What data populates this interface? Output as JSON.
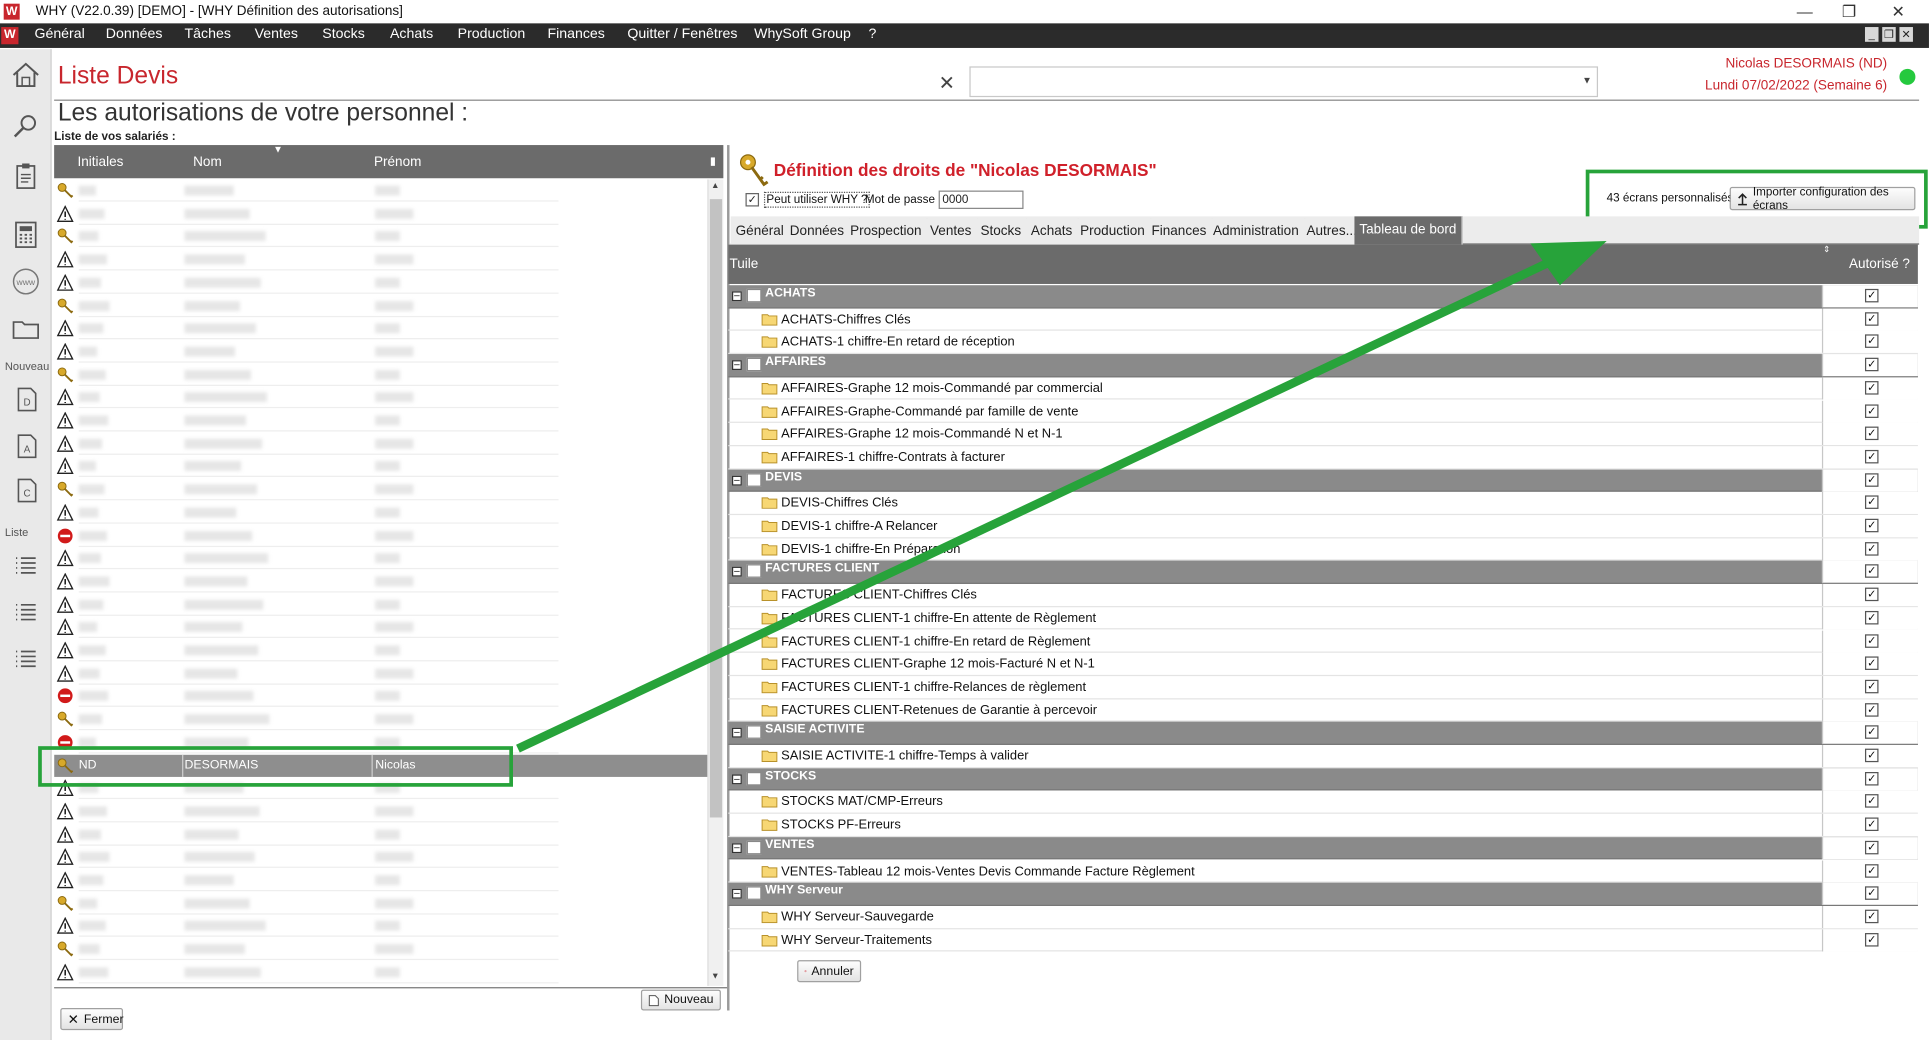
{
  "window": {
    "title": "WHY (V22.0.39)  [DEMO] - [WHY Définition des autorisations]",
    "logo": "W"
  },
  "menu": {
    "items": [
      "Général",
      "Données",
      "Tâches",
      "Ventes",
      "Stocks",
      "Achats",
      "Production",
      "Finances",
      "Quitter / Fenêtres",
      "WhySoft Group",
      "?"
    ]
  },
  "sidebar": {
    "nouveau_label": "Nouveau",
    "liste_label": "Liste"
  },
  "header": {
    "page_title": "Liste Devis",
    "user_name": "Nicolas DESORMAIS (ND)",
    "user_date": "Lundi 07/02/2022 (Semaine 6)",
    "status_color": "#25c93e"
  },
  "main": {
    "subtitle": "Les autorisations de votre personnel :",
    "employees_label": "Liste de vos salariés :"
  },
  "employees": {
    "columns": [
      "Initiales",
      "Nom",
      "Prénom"
    ],
    "selected": {
      "initials": "ND",
      "nom": "DESORMAIS",
      "prenom": "Nicolas"
    },
    "row_statuses": [
      "key",
      "warn",
      "key",
      "warn",
      "warn",
      "key",
      "warn",
      "warn",
      "key",
      "warn",
      "warn",
      "warn",
      "warn",
      "key",
      "warn",
      "stop",
      "warn",
      "warn",
      "warn",
      "warn",
      "warn",
      "warn",
      "stop",
      "key",
      "stop",
      "key",
      "warn",
      "warn",
      "warn",
      "warn",
      "warn",
      "key",
      "warn",
      "key",
      "warn"
    ],
    "selected_index": 25
  },
  "buttons": {
    "fermer": "Fermer",
    "nouveau": "Nouveau",
    "annuler": "Annuler",
    "import": "Importer configuration des écrans"
  },
  "rights": {
    "title": "Définition des droits de \"Nicolas DESORMAIS\"",
    "can_use_label": "Peut utiliser WHY ?",
    "can_use_checked": true,
    "password_label": "Mot de passe :",
    "password_value": "0000",
    "screens_count": "43 écrans personnalisés",
    "tabs": [
      "Général",
      "Données",
      "Prospection",
      "Ventes",
      "Stocks",
      "Achats",
      "Production",
      "Finances",
      "Administration",
      "Autres...",
      "Tableau de bord"
    ],
    "active_tab": "Tableau de bord",
    "grid_headers": {
      "tuile": "Tuile",
      "autorise": "Autorisé ?"
    },
    "rows": [
      {
        "type": "group",
        "label": "ACHATS"
      },
      {
        "type": "item",
        "label": "ACHATS-Chiffres Clés"
      },
      {
        "type": "item",
        "label": "ACHATS-1 chiffre-En retard de réception"
      },
      {
        "type": "group",
        "label": "AFFAIRES"
      },
      {
        "type": "item",
        "label": "AFFAIRES-Graphe 12 mois-Commandé par commercial"
      },
      {
        "type": "item",
        "label": "AFFAIRES-Graphe-Commandé par famille de vente"
      },
      {
        "type": "item",
        "label": "AFFAIRES-Graphe 12 mois-Commandé N et N-1"
      },
      {
        "type": "item",
        "label": "AFFAIRES-1 chiffre-Contrats à facturer"
      },
      {
        "type": "group",
        "label": "DEVIS"
      },
      {
        "type": "item",
        "label": "DEVIS-Chiffres Clés"
      },
      {
        "type": "item",
        "label": "DEVIS-1 chiffre-A Relancer"
      },
      {
        "type": "item",
        "label": "DEVIS-1 chiffre-En Préparation"
      },
      {
        "type": "group",
        "label": "FACTURES CLIENT"
      },
      {
        "type": "item",
        "label": "FACTURES CLIENT-Chiffres Clés"
      },
      {
        "type": "item",
        "label": "FACTURES CLIENT-1 chiffre-En attente de Règlement"
      },
      {
        "type": "item",
        "label": "FACTURES CLIENT-1 chiffre-En retard de Règlement"
      },
      {
        "type": "item",
        "label": "FACTURES CLIENT-Graphe 12 mois-Facturé N et N-1"
      },
      {
        "type": "item",
        "label": "FACTURES CLIENT-1 chiffre-Relances de règlement"
      },
      {
        "type": "item",
        "label": "FACTURES CLIENT-Retenues de Garantie à percevoir"
      },
      {
        "type": "group",
        "label": "SAISIE ACTIVITE"
      },
      {
        "type": "item",
        "label": "SAISIE ACTIVITE-1 chiffre-Temps à valider"
      },
      {
        "type": "group",
        "label": "STOCKS"
      },
      {
        "type": "item",
        "label": "STOCKS MAT/CMP-Erreurs"
      },
      {
        "type": "item",
        "label": "STOCKS PF-Erreurs"
      },
      {
        "type": "group",
        "label": "VENTES"
      },
      {
        "type": "item",
        "label": "VENTES-Tableau 12 mois-Ventes Devis Commande Facture Règlement"
      },
      {
        "type": "group",
        "label": "WHY Serveur"
      },
      {
        "type": "item",
        "label": "WHY Serveur-Sauvegarde"
      },
      {
        "type": "item",
        "label": "WHY Serveur-Traitements"
      }
    ]
  },
  "colors": {
    "brand_red": "#c8262d",
    "title_red": "#d0202a",
    "annotation_green": "#27a33a",
    "header_gray": "#6b6b6b",
    "group_gray": "#8a8a8a"
  }
}
